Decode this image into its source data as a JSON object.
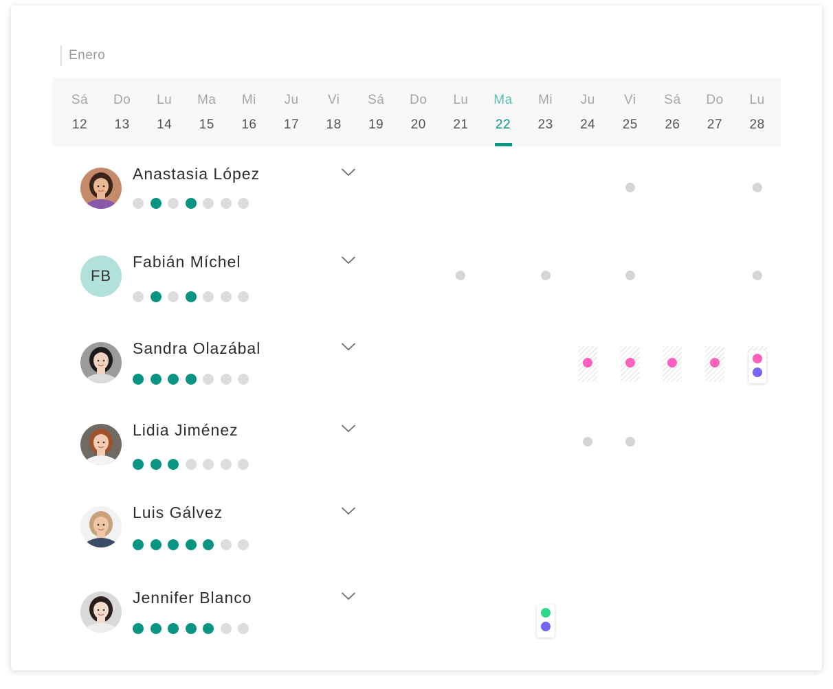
{
  "month": "Enero",
  "days": [
    {
      "name": "Sá",
      "date": "12"
    },
    {
      "name": "Do",
      "date": "13"
    },
    {
      "name": "Lu",
      "date": "14"
    },
    {
      "name": "Ma",
      "date": "15"
    },
    {
      "name": "Mi",
      "date": "16"
    },
    {
      "name": "Ju",
      "date": "17"
    },
    {
      "name": "Vi",
      "date": "18"
    },
    {
      "name": "Sá",
      "date": "19"
    },
    {
      "name": "Do",
      "date": "20"
    },
    {
      "name": "Lu",
      "date": "21"
    },
    {
      "name": "Ma",
      "date": "22",
      "today": true
    },
    {
      "name": "Mi",
      "date": "23"
    },
    {
      "name": "Ju",
      "date": "24"
    },
    {
      "name": "Vi",
      "date": "25"
    },
    {
      "name": "Sá",
      "date": "26"
    },
    {
      "name": "Do",
      "date": "27"
    },
    {
      "name": "Lu",
      "date": "28"
    }
  ],
  "colors": {
    "accent": "#0a9583",
    "inactive_dot": "#dddddd",
    "event_grey": "#d5d5d5",
    "event_pink": "#ff5fbe",
    "event_purple": "#7466f0",
    "event_green": "#2ed88a"
  },
  "people": [
    {
      "name": "Anastasia López",
      "avatar": "photo",
      "icon": "avatar-photo",
      "level": [
        0,
        1,
        0,
        1,
        0,
        0,
        0
      ],
      "events": [
        {
          "date": "25",
          "dots": [
            "grey"
          ]
        },
        {
          "date": "28",
          "dots": [
            "grey"
          ]
        }
      ]
    },
    {
      "name": "Fabián Míchel",
      "avatar": "initials",
      "initials": "FB",
      "level": [
        0,
        1,
        0,
        1,
        0,
        0,
        0
      ],
      "events": [
        {
          "date": "21",
          "dots": [
            "grey"
          ]
        },
        {
          "date": "23",
          "dots": [
            "grey"
          ]
        },
        {
          "date": "25",
          "dots": [
            "grey"
          ]
        },
        {
          "date": "28",
          "dots": [
            "grey"
          ]
        }
      ]
    },
    {
      "name": "Sandra Olazábal",
      "avatar": "photo",
      "icon": "avatar-photo",
      "level": [
        1,
        1,
        1,
        1,
        0,
        0,
        0
      ],
      "events": [
        {
          "date": "24",
          "dots": [
            "pink"
          ],
          "hatched": true
        },
        {
          "date": "25",
          "dots": [
            "pink"
          ],
          "hatched": true
        },
        {
          "date": "26",
          "dots": [
            "pink"
          ],
          "hatched": true
        },
        {
          "date": "27",
          "dots": [
            "pink"
          ],
          "hatched": true
        },
        {
          "date": "28",
          "dots": [
            "pink",
            "purple"
          ],
          "hatched": true,
          "selected": true
        }
      ]
    },
    {
      "name": "Lidia Jiménez",
      "avatar": "photo",
      "icon": "avatar-photo",
      "level": [
        1,
        1,
        1,
        0,
        0,
        0,
        0
      ],
      "events": [
        {
          "date": "24",
          "dots": [
            "grey"
          ]
        },
        {
          "date": "25",
          "dots": [
            "grey"
          ]
        }
      ]
    },
    {
      "name": "Luis Gálvez",
      "avatar": "photo",
      "icon": "avatar-photo",
      "level": [
        1,
        1,
        1,
        1,
        1,
        0,
        0
      ],
      "events": []
    },
    {
      "name": "Jennifer Blanco",
      "avatar": "photo",
      "icon": "avatar-photo",
      "level": [
        1,
        1,
        1,
        1,
        1,
        0,
        0
      ],
      "events": [
        {
          "date": "23",
          "dots": [
            "green",
            "purple"
          ],
          "selected": true
        }
      ]
    }
  ]
}
